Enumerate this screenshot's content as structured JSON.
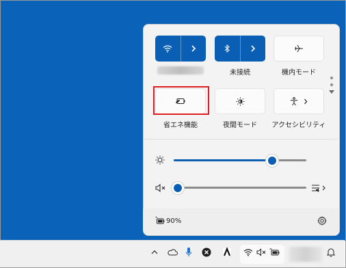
{
  "quick_settings": {
    "tiles": [
      {
        "name": "wifi",
        "label": "",
        "state": "on",
        "expandable": true
      },
      {
        "name": "bluetooth",
        "label": "未接続",
        "state": "on",
        "expandable": true
      },
      {
        "name": "airplane-mode",
        "label": "機内モード",
        "state": "off",
        "expandable": false
      },
      {
        "name": "energy-saver",
        "label": "省エネ機能",
        "state": "off",
        "expandable": false
      },
      {
        "name": "night-light",
        "label": "夜間モード",
        "state": "off",
        "expandable": false
      },
      {
        "name": "accessibility",
        "label": "アクセシビリティ",
        "state": "off",
        "expandable": true
      }
    ],
    "brightness": {
      "level": 0.74
    },
    "volume": {
      "level": 0.0,
      "muted": true
    },
    "battery": {
      "percent": "90%"
    }
  },
  "colors": {
    "desktop": "#0a63b8",
    "accent": "#0a5fb4",
    "highlight": "#e11b22",
    "panel": "#f3f3f3",
    "taskbar": "#f0f0f0"
  },
  "taskbar": {
    "tray_icons": [
      "chevron-up-icon",
      "onedrive-cloud-icon",
      "microphone-icon",
      "close-circle-icon",
      "app-a-icon",
      "wifi-icon",
      "speaker-muted-icon",
      "battery-saver-icon",
      "notification-bell-icon"
    ]
  }
}
